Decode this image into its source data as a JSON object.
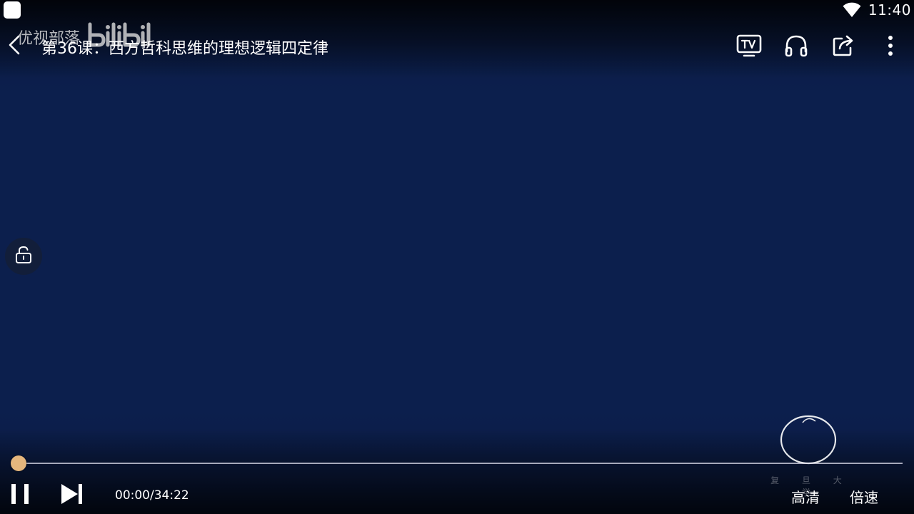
{
  "status_bar": {
    "time": "11:40",
    "icons": [
      "app-notification-icon",
      "wifi-icon"
    ]
  },
  "watermark": {
    "text": "优视部落",
    "logo": "bilibili-logo"
  },
  "header": {
    "title": "第36课：西方哲科思维的理想逻辑四定律",
    "actions": [
      "tv-cast-icon",
      "headphones-icon",
      "share-icon",
      "more-icon"
    ]
  },
  "player": {
    "current_time": "00:00",
    "total_time": "34:22",
    "separator": "/",
    "progress_fraction": 0.0,
    "quality_label": "高清",
    "speed_label": "倍速",
    "seal_caption": "复 旦 大 学"
  },
  "colors": {
    "video_background": "#0c1f4d",
    "progress_thumb": "#e6b77d",
    "progress_track": "#dcdceb"
  }
}
